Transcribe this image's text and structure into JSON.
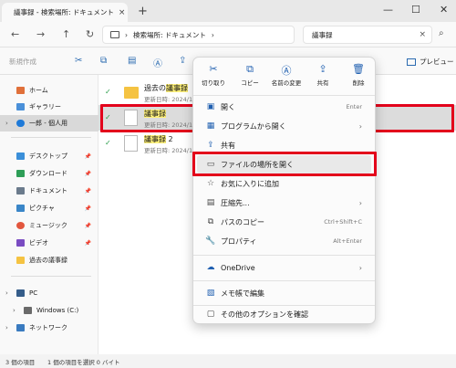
{
  "window": {
    "tab_title": "議事録 - 検索場所: ドキュメント",
    "tab_close": "×",
    "new_tab": "+",
    "minimize": "—",
    "maximize": "☐",
    "close": "✕"
  },
  "nav": {
    "back": "←",
    "forward": "→",
    "up": "↑",
    "refresh": "↻",
    "breadcrumb_sep": "›",
    "address": "検索場所: ドキュメント",
    "address_chevron": "›",
    "search_value": "議事録",
    "search_clear": "×"
  },
  "toolbar": {
    "new_label": "新規作成",
    "preview_label": "プレビュー"
  },
  "sidebar": {
    "items": [
      {
        "label": "ホーム",
        "color": "#e0703a"
      },
      {
        "label": "ギャラリー",
        "color": "#4a90d9"
      },
      {
        "label": "一郎 - 個人用",
        "color": "#1f7ad8"
      },
      {
        "label": "デスクトップ",
        "color": "#3b8fd9"
      },
      {
        "label": "ダウンロード",
        "color": "#2e9e57"
      },
      {
        "label": "ドキュメント",
        "color": "#6b7b8c"
      },
      {
        "label": "ピクチャ",
        "color": "#3a86c8"
      },
      {
        "label": "ミュージック",
        "color": "#e2563e"
      },
      {
        "label": "ビデオ",
        "color": "#7a4cc2"
      },
      {
        "label": "過去の議事録",
        "color": "#f5c342"
      },
      {
        "label": "PC",
        "color": "#355d8a"
      },
      {
        "label": "Windows (C:)",
        "color": "#6a6a6a"
      },
      {
        "label": "ネットワーク",
        "color": "#3a7bc0"
      }
    ],
    "pin": "📌"
  },
  "files": [
    {
      "name_pre": "過去の",
      "name_hl": "議事録",
      "name_post": "",
      "meta": "更新日時: 2024/1("
    },
    {
      "name_pre": "",
      "name_hl": "議事録",
      "name_post": "",
      "meta": "更新日時: 2024/1("
    },
    {
      "name_pre": "",
      "name_hl": "議事録",
      "name_post": " 2",
      "meta": "更新日時: 2024/1("
    }
  ],
  "check_mark": "✓",
  "status": {
    "count": "3 個の項目",
    "selected": "1 個の項目を選択 0 バイト"
  },
  "context_menu": {
    "quick_actions": [
      {
        "icon": "✂",
        "label": "切り取り"
      },
      {
        "icon": "⧉",
        "label": "コピー"
      },
      {
        "icon": "Ⓐ",
        "label": "名前の変更"
      },
      {
        "icon": "⇪",
        "label": "共有"
      },
      {
        "icon": "🗑",
        "label": "削除"
      }
    ],
    "items": [
      {
        "icon": "▣",
        "label": "開く",
        "shortcut": "Enter"
      },
      {
        "icon": "▦",
        "label": "プログラムから開く",
        "arrow": "›"
      },
      {
        "icon": "⇪",
        "label": "共有"
      },
      {
        "icon": "▭",
        "label": "ファイルの場所を開く"
      },
      {
        "icon": "☆",
        "label": "お気に入りに追加"
      },
      {
        "icon": "▤",
        "label": "圧縮先...",
        "arrow": "›"
      },
      {
        "icon": "⧉",
        "label": "パスのコピー",
        "shortcut": "Ctrl+Shift+C"
      },
      {
        "icon": "🔧",
        "label": "プロパティ",
        "shortcut": "Alt+Enter"
      },
      {
        "icon": "☁",
        "label": "OneDrive",
        "arrow": "›"
      },
      {
        "icon": "▧",
        "label": "メモ帳で編集"
      },
      {
        "icon": "▢",
        "label": "その他のオプションを確認"
      }
    ]
  },
  "colors": {
    "highlight_box": "#e3001b",
    "search_highlight": "#fff17a",
    "accent": "#1f5fb0"
  }
}
